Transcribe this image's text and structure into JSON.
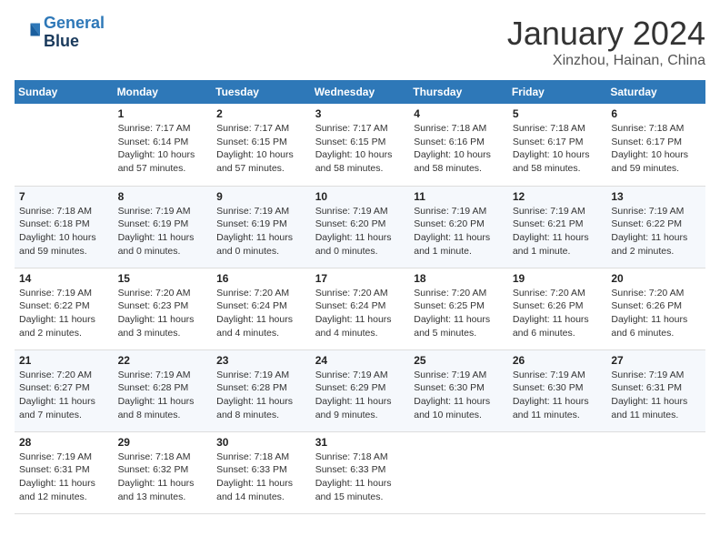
{
  "logo": {
    "line1": "General",
    "line2": "Blue"
  },
  "title": "January 2024",
  "location": "Xinzhou, Hainan, China",
  "weekdays": [
    "Sunday",
    "Monday",
    "Tuesday",
    "Wednesday",
    "Thursday",
    "Friday",
    "Saturday"
  ],
  "weeks": [
    [
      {
        "day": "",
        "sunrise": "",
        "sunset": "",
        "daylight": ""
      },
      {
        "day": "1",
        "sunrise": "Sunrise: 7:17 AM",
        "sunset": "Sunset: 6:14 PM",
        "daylight": "Daylight: 10 hours and 57 minutes."
      },
      {
        "day": "2",
        "sunrise": "Sunrise: 7:17 AM",
        "sunset": "Sunset: 6:15 PM",
        "daylight": "Daylight: 10 hours and 57 minutes."
      },
      {
        "day": "3",
        "sunrise": "Sunrise: 7:17 AM",
        "sunset": "Sunset: 6:15 PM",
        "daylight": "Daylight: 10 hours and 58 minutes."
      },
      {
        "day": "4",
        "sunrise": "Sunrise: 7:18 AM",
        "sunset": "Sunset: 6:16 PM",
        "daylight": "Daylight: 10 hours and 58 minutes."
      },
      {
        "day": "5",
        "sunrise": "Sunrise: 7:18 AM",
        "sunset": "Sunset: 6:17 PM",
        "daylight": "Daylight: 10 hours and 58 minutes."
      },
      {
        "day": "6",
        "sunrise": "Sunrise: 7:18 AM",
        "sunset": "Sunset: 6:17 PM",
        "daylight": "Daylight: 10 hours and 59 minutes."
      }
    ],
    [
      {
        "day": "7",
        "sunrise": "Sunrise: 7:18 AM",
        "sunset": "Sunset: 6:18 PM",
        "daylight": "Daylight: 10 hours and 59 minutes."
      },
      {
        "day": "8",
        "sunrise": "Sunrise: 7:19 AM",
        "sunset": "Sunset: 6:19 PM",
        "daylight": "Daylight: 11 hours and 0 minutes."
      },
      {
        "day": "9",
        "sunrise": "Sunrise: 7:19 AM",
        "sunset": "Sunset: 6:19 PM",
        "daylight": "Daylight: 11 hours and 0 minutes."
      },
      {
        "day": "10",
        "sunrise": "Sunrise: 7:19 AM",
        "sunset": "Sunset: 6:20 PM",
        "daylight": "Daylight: 11 hours and 0 minutes."
      },
      {
        "day": "11",
        "sunrise": "Sunrise: 7:19 AM",
        "sunset": "Sunset: 6:20 PM",
        "daylight": "Daylight: 11 hours and 1 minute."
      },
      {
        "day": "12",
        "sunrise": "Sunrise: 7:19 AM",
        "sunset": "Sunset: 6:21 PM",
        "daylight": "Daylight: 11 hours and 1 minute."
      },
      {
        "day": "13",
        "sunrise": "Sunrise: 7:19 AM",
        "sunset": "Sunset: 6:22 PM",
        "daylight": "Daylight: 11 hours and 2 minutes."
      }
    ],
    [
      {
        "day": "14",
        "sunrise": "Sunrise: 7:19 AM",
        "sunset": "Sunset: 6:22 PM",
        "daylight": "Daylight: 11 hours and 2 minutes."
      },
      {
        "day": "15",
        "sunrise": "Sunrise: 7:20 AM",
        "sunset": "Sunset: 6:23 PM",
        "daylight": "Daylight: 11 hours and 3 minutes."
      },
      {
        "day": "16",
        "sunrise": "Sunrise: 7:20 AM",
        "sunset": "Sunset: 6:24 PM",
        "daylight": "Daylight: 11 hours and 4 minutes."
      },
      {
        "day": "17",
        "sunrise": "Sunrise: 7:20 AM",
        "sunset": "Sunset: 6:24 PM",
        "daylight": "Daylight: 11 hours and 4 minutes."
      },
      {
        "day": "18",
        "sunrise": "Sunrise: 7:20 AM",
        "sunset": "Sunset: 6:25 PM",
        "daylight": "Daylight: 11 hours and 5 minutes."
      },
      {
        "day": "19",
        "sunrise": "Sunrise: 7:20 AM",
        "sunset": "Sunset: 6:26 PM",
        "daylight": "Daylight: 11 hours and 6 minutes."
      },
      {
        "day": "20",
        "sunrise": "Sunrise: 7:20 AM",
        "sunset": "Sunset: 6:26 PM",
        "daylight": "Daylight: 11 hours and 6 minutes."
      }
    ],
    [
      {
        "day": "21",
        "sunrise": "Sunrise: 7:20 AM",
        "sunset": "Sunset: 6:27 PM",
        "daylight": "Daylight: 11 hours and 7 minutes."
      },
      {
        "day": "22",
        "sunrise": "Sunrise: 7:19 AM",
        "sunset": "Sunset: 6:28 PM",
        "daylight": "Daylight: 11 hours and 8 minutes."
      },
      {
        "day": "23",
        "sunrise": "Sunrise: 7:19 AM",
        "sunset": "Sunset: 6:28 PM",
        "daylight": "Daylight: 11 hours and 8 minutes."
      },
      {
        "day": "24",
        "sunrise": "Sunrise: 7:19 AM",
        "sunset": "Sunset: 6:29 PM",
        "daylight": "Daylight: 11 hours and 9 minutes."
      },
      {
        "day": "25",
        "sunrise": "Sunrise: 7:19 AM",
        "sunset": "Sunset: 6:30 PM",
        "daylight": "Daylight: 11 hours and 10 minutes."
      },
      {
        "day": "26",
        "sunrise": "Sunrise: 7:19 AM",
        "sunset": "Sunset: 6:30 PM",
        "daylight": "Daylight: 11 hours and 11 minutes."
      },
      {
        "day": "27",
        "sunrise": "Sunrise: 7:19 AM",
        "sunset": "Sunset: 6:31 PM",
        "daylight": "Daylight: 11 hours and 11 minutes."
      }
    ],
    [
      {
        "day": "28",
        "sunrise": "Sunrise: 7:19 AM",
        "sunset": "Sunset: 6:31 PM",
        "daylight": "Daylight: 11 hours and 12 minutes."
      },
      {
        "day": "29",
        "sunrise": "Sunrise: 7:18 AM",
        "sunset": "Sunset: 6:32 PM",
        "daylight": "Daylight: 11 hours and 13 minutes."
      },
      {
        "day": "30",
        "sunrise": "Sunrise: 7:18 AM",
        "sunset": "Sunset: 6:33 PM",
        "daylight": "Daylight: 11 hours and 14 minutes."
      },
      {
        "day": "31",
        "sunrise": "Sunrise: 7:18 AM",
        "sunset": "Sunset: 6:33 PM",
        "daylight": "Daylight: 11 hours and 15 minutes."
      },
      {
        "day": "",
        "sunrise": "",
        "sunset": "",
        "daylight": ""
      },
      {
        "day": "",
        "sunrise": "",
        "sunset": "",
        "daylight": ""
      },
      {
        "day": "",
        "sunrise": "",
        "sunset": "",
        "daylight": ""
      }
    ]
  ]
}
